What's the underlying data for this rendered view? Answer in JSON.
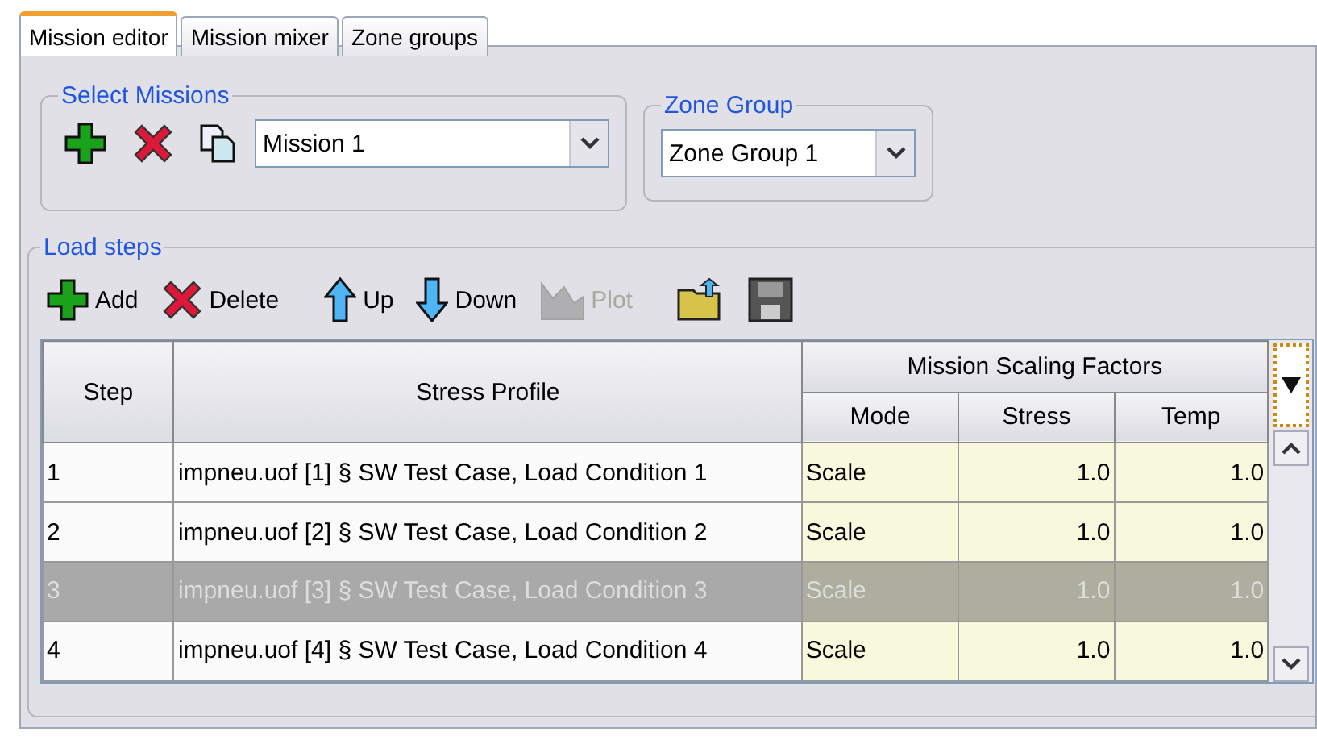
{
  "tabs": [
    {
      "label": "Mission editor",
      "selected": true
    },
    {
      "label": "Mission mixer",
      "selected": false
    },
    {
      "label": "Zone groups",
      "selected": false
    }
  ],
  "select_missions": {
    "title": "Select Missions",
    "tools": [
      {
        "kind": "add"
      },
      {
        "kind": "delete"
      },
      {
        "kind": "copy"
      }
    ],
    "mission": {
      "value": "Mission 1"
    }
  },
  "zone_group": {
    "title": "Zone Group",
    "value": "Zone Group 1"
  },
  "load_steps": {
    "title": "Load steps",
    "toolbar": [
      {
        "kind": "add",
        "label": "Add",
        "disabled": false
      },
      {
        "kind": "delete",
        "label": "Delete",
        "disabled": false
      },
      {
        "kind": "up",
        "label": "Up",
        "disabled": false
      },
      {
        "kind": "down",
        "label": "Down",
        "disabled": false
      },
      {
        "kind": "plot",
        "label": "Plot",
        "disabled": true
      },
      {
        "kind": "open",
        "disabled": false
      },
      {
        "kind": "save",
        "disabled": false
      }
    ],
    "table": {
      "columns": [
        "Step",
        "Stress Profile"
      ],
      "group_header": "Mission Scaling Factors",
      "sub_columns": [
        "Mode",
        "Stress",
        "Temp"
      ],
      "rows": [
        {
          "step": "1",
          "profile": "impneu.uof [1] § SW Test Case, Load Condition 1",
          "mode": "Scale",
          "stress": "1.0",
          "temp": "1.0",
          "selected": false
        },
        {
          "step": "2",
          "profile": "impneu.uof [2] § SW Test Case, Load Condition 2",
          "mode": "Scale",
          "stress": "1.0",
          "temp": "1.0",
          "selected": false
        },
        {
          "step": "3",
          "profile": "impneu.uof [3] § SW Test Case, Load Condition 3",
          "mode": "Scale",
          "stress": "1.0",
          "temp": "1.0",
          "selected": true
        },
        {
          "step": "4",
          "profile": "impneu.uof [4] § SW Test Case, Load Condition 4",
          "mode": "Scale",
          "stress": "1.0",
          "temp": "1.0",
          "selected": false
        }
      ]
    }
  }
}
